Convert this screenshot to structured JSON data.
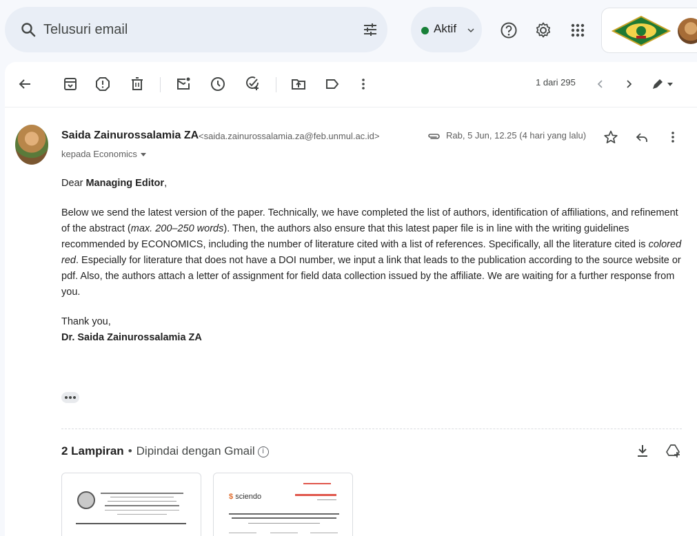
{
  "search": {
    "placeholder": "Telusuri email"
  },
  "status": {
    "label": "Aktif",
    "color": "#188038"
  },
  "pager": {
    "text": "1 dari 295"
  },
  "toolbar": {
    "icons": [
      "back-arrow-icon",
      "archive-icon",
      "report-spam-icon",
      "delete-icon",
      "mark-unread-icon",
      "snooze-icon",
      "add-task-icon",
      "move-to-icon",
      "label-icon",
      "more-vert-icon",
      "prev-icon",
      "next-icon",
      "pen-icon"
    ]
  },
  "email": {
    "sender_name": "Saida Zainurossalamia ZA",
    "sender_email": "<saida.zainurossalamia.za@feb.unmul.ac.id>",
    "recipient": "kepada Economics",
    "date": "Rab, 5 Jun, 12.25 (4 hari yang lalu)",
    "greeting_prefix": "Dear ",
    "greeting_bold": "Managing Editor",
    "greeting_suffix": ",",
    "p1_a": "Below we send the latest version of the paper. Technically, we have completed the list of authors, identification of affiliations, and refinement of the abstract (",
    "p1_i1": "max. 200–250 words",
    "p1_b": "). Then, the authors also ensure that this latest paper file is in line with the writing guidelines recommended by ECONOMICS, including the number of literature cited with a list of references. Specifically, all the literature cited is ",
    "p1_i2": "colored red",
    "p1_c": ". Especially for literature that does not have a DOI number, we input a link that leads to the publication according to the source website or pdf. Also, the authors attach a letter of assignment for field data collection issued by the affiliate. We are waiting for a further response from you.",
    "closing": "Thank you,",
    "signature": "Dr. Saida Zainurossalamia ZA"
  },
  "attachments": {
    "count_label": "2 Lampiran",
    "bullet": "•",
    "scan_label": "Dipindai dengan Gmail",
    "info": "i",
    "thumb1_text": "KEMENTERIAN PENDIDIKAN, KEBUDAYAAN RISET DAN TEKNOLOGI UNIVERSITAS MULAWARMAN FAKULTAS EKONOMI DAN BISNIS",
    "thumb2_brand": "sciendo",
    "thumb2_title": "DOES CREATIVITY AND PRODUCT INNOVATION BUILD BUSINESS CONTINUITY? INVESTIGATION OF SAMARINDA WEAVING CRAFT"
  }
}
